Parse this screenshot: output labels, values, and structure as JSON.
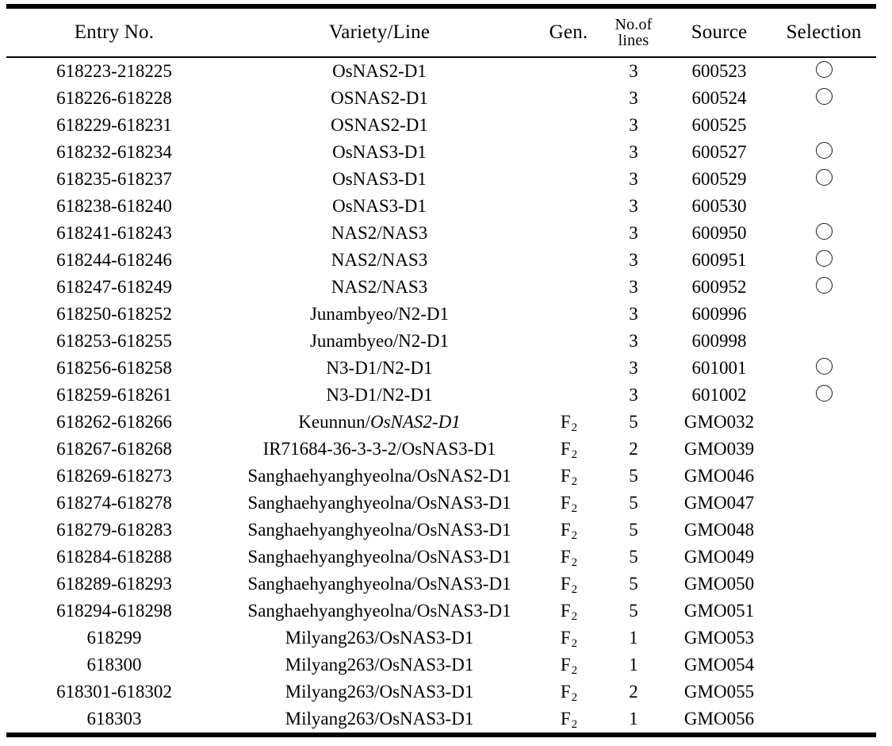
{
  "table": {
    "caption_visible": false,
    "columns": [
      {
        "key": "entry",
        "label": "Entry No."
      },
      {
        "key": "variety",
        "label": "Variety/Line"
      },
      {
        "key": "gen",
        "label": "Gen."
      },
      {
        "key": "lines",
        "label_line1": "No.of",
        "label_line2": "lines"
      },
      {
        "key": "source",
        "label": "Source"
      },
      {
        "key": "select",
        "label": "Selection"
      }
    ],
    "selection_marker": "○",
    "rows": [
      {
        "entry": "618223-218225",
        "variety": "OsNAS2-D1",
        "variety_italic": "",
        "gen": "",
        "lines": "3",
        "source": "600523",
        "select": "○"
      },
      {
        "entry": "618226-618228",
        "variety": "OSNAS2-D1",
        "variety_italic": "",
        "gen": "",
        "lines": "3",
        "source": "600524",
        "select": "○"
      },
      {
        "entry": "618229-618231",
        "variety": "OSNAS2-D1",
        "variety_italic": "",
        "gen": "",
        "lines": "3",
        "source": "600525",
        "select": ""
      },
      {
        "entry": "618232-618234",
        "variety": "OsNAS3-D1",
        "variety_italic": "",
        "gen": "",
        "lines": "3",
        "source": "600527",
        "select": "○"
      },
      {
        "entry": "618235-618237",
        "variety": "OsNAS3-D1",
        "variety_italic": "",
        "gen": "",
        "lines": "3",
        "source": "600529",
        "select": "○"
      },
      {
        "entry": "618238-618240",
        "variety": "OsNAS3-D1",
        "variety_italic": "",
        "gen": "",
        "lines": "3",
        "source": "600530",
        "select": ""
      },
      {
        "entry": "618241-618243",
        "variety": "NAS2/NAS3",
        "variety_italic": "",
        "gen": "",
        "lines": "3",
        "source": "600950",
        "select": "○"
      },
      {
        "entry": "618244-618246",
        "variety": "NAS2/NAS3",
        "variety_italic": "",
        "gen": "",
        "lines": "3",
        "source": "600951",
        "select": "○"
      },
      {
        "entry": "618247-618249",
        "variety": "NAS2/NAS3",
        "variety_italic": "",
        "gen": "",
        "lines": "3",
        "source": "600952",
        "select": "○"
      },
      {
        "entry": "618250-618252",
        "variety": "Junambyeo/N2-D1",
        "variety_italic": "",
        "gen": "",
        "lines": "3",
        "source": "600996",
        "select": ""
      },
      {
        "entry": "618253-618255",
        "variety": "Junambyeo/N2-D1",
        "variety_italic": "",
        "gen": "",
        "lines": "3",
        "source": "600998",
        "select": ""
      },
      {
        "entry": "618256-618258",
        "variety": "N3-D1/N2-D1",
        "variety_italic": "",
        "gen": "",
        "lines": "3",
        "source": "601001",
        "select": "○"
      },
      {
        "entry": "618259-618261",
        "variety": "N3-D1/N2-D1",
        "variety_italic": "",
        "gen": "",
        "lines": "3",
        "source": "601002",
        "select": "○"
      },
      {
        "entry": "618262-618266",
        "variety": "Keunnun/",
        "variety_italic": "OsNAS2-D1",
        "gen": "F2",
        "lines": "5",
        "source": "GMO032",
        "select": ""
      },
      {
        "entry": "618267-618268",
        "variety": "IR71684-36-3-3-2/OsNAS3-D1",
        "variety_italic": "",
        "gen": "F2",
        "lines": "2",
        "source": "GMO039",
        "select": ""
      },
      {
        "entry": "618269-618273",
        "variety": "Sanghaehyanghyeolna/OsNAS2-D1",
        "variety_italic": "",
        "gen": "F2",
        "lines": "5",
        "source": "GMO046",
        "select": ""
      },
      {
        "entry": "618274-618278",
        "variety": "Sanghaehyanghyeolna/OsNAS3-D1",
        "variety_italic": "",
        "gen": "F2",
        "lines": "5",
        "source": "GMO047",
        "select": ""
      },
      {
        "entry": "618279-618283",
        "variety": "Sanghaehyanghyeolna/OsNAS3-D1",
        "variety_italic": "",
        "gen": "F2",
        "lines": "5",
        "source": "GMO048",
        "select": ""
      },
      {
        "entry": "618284-618288",
        "variety": "Sanghaehyanghyeolna/OsNAS3-D1",
        "variety_italic": "",
        "gen": "F2",
        "lines": "5",
        "source": "GMO049",
        "select": ""
      },
      {
        "entry": "618289-618293",
        "variety": "Sanghaehyanghyeolna/OsNAS3-D1",
        "variety_italic": "",
        "gen": "F2",
        "lines": "5",
        "source": "GMO050",
        "select": ""
      },
      {
        "entry": "618294-618298",
        "variety": "Sanghaehyanghyeolna/OsNAS3-D1",
        "variety_italic": "",
        "gen": "F2",
        "lines": "5",
        "source": "GMO051",
        "select": ""
      },
      {
        "entry": "618299",
        "variety": "Milyang263/OsNAS3-D1",
        "variety_italic": "",
        "gen": "F2",
        "lines": "1",
        "source": "GMO053",
        "select": ""
      },
      {
        "entry": "618300",
        "variety": "Milyang263/OsNAS3-D1",
        "variety_italic": "",
        "gen": "F2",
        "lines": "1",
        "source": "GMO054",
        "select": ""
      },
      {
        "entry": "618301-618302",
        "variety": "Milyang263/OsNAS3-D1",
        "variety_italic": "",
        "gen": "F2",
        "lines": "2",
        "source": "GMO055",
        "select": ""
      },
      {
        "entry": "618303",
        "variety": "Milyang263/OsNAS3-D1",
        "variety_italic": "",
        "gen": "F2",
        "lines": "1",
        "source": "GMO056",
        "select": ""
      }
    ]
  }
}
